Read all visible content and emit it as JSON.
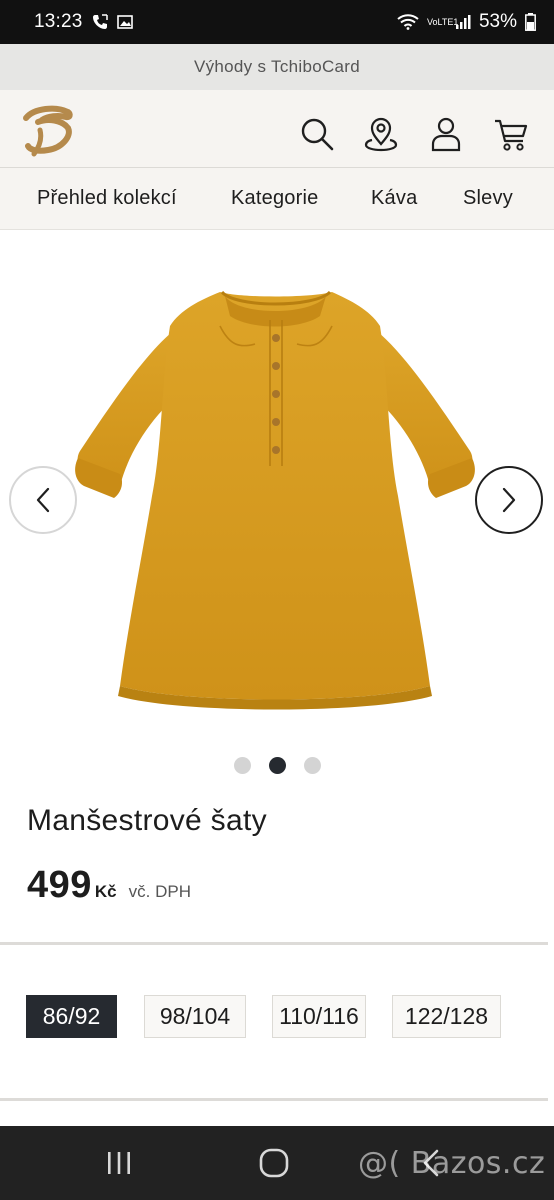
{
  "status_bar": {
    "time": "13:23",
    "battery": "53%",
    "network_label": "VoLTE1"
  },
  "promo": {
    "text": "Výhody s TchiboCard"
  },
  "header": {
    "icons": [
      "search-icon",
      "store-locator-icon",
      "account-icon",
      "cart-icon"
    ]
  },
  "nav": {
    "items": [
      {
        "label": "Přehled kolekcí"
      },
      {
        "label": "Kategorie"
      },
      {
        "label": "Káva"
      },
      {
        "label": "Slevy"
      }
    ]
  },
  "gallery": {
    "current_slide": 2,
    "slide_count": 3,
    "image_description": "mustard corduroy dress"
  },
  "product": {
    "title": "Manšestrové šaty",
    "price": "499",
    "currency": "Kč",
    "vat_note": "vč. DPH"
  },
  "sizes": {
    "options": [
      "86/92",
      "98/104",
      "110/116",
      "122/128"
    ],
    "selected": "86/92"
  },
  "watermark": {
    "text": "@( Bazos.cz"
  },
  "colors": {
    "accent_dark": "#262a30",
    "logo_gold": "#b58a4c",
    "dress_mustard": "#d69a1c",
    "header_bg": "#f6f4f1"
  }
}
